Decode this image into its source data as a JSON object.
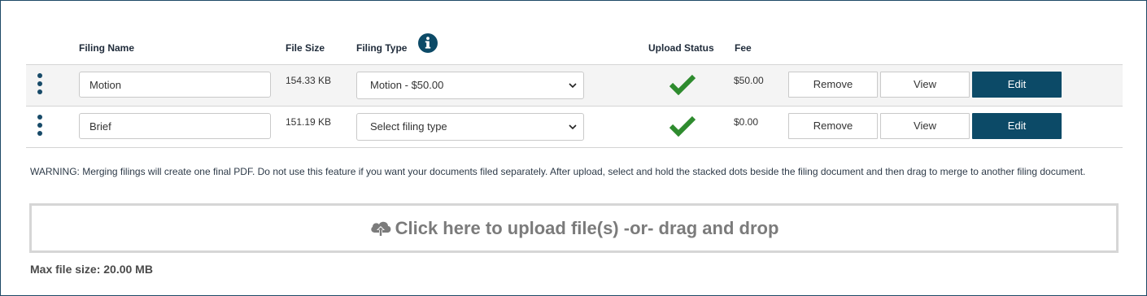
{
  "headers": {
    "filing_name": "Filing Name",
    "file_size": "File Size",
    "filing_type": "Filing Type",
    "upload_status": "Upload Status",
    "fee": "Fee"
  },
  "rows": [
    {
      "name": "Motion",
      "size": "154.33 KB",
      "type": "Motion - $50.00",
      "status": "uploaded",
      "fee": "$50.00",
      "remove_label": "Remove",
      "view_label": "View",
      "edit_label": "Edit"
    },
    {
      "name": "Brief",
      "size": "151.19 KB",
      "type": "Select filing type",
      "status": "uploaded",
      "fee": "$0.00",
      "remove_label": "Remove",
      "view_label": "View",
      "edit_label": "Edit"
    }
  ],
  "warning": "WARNING: Merging filings will create one final PDF. Do not use this feature if you want your documents filed separately. After upload, select and hold the stacked dots beside the filing document and then drag to merge to another filing document.",
  "upload": {
    "label": "Click here to upload file(s) -or- drag and drop",
    "icon": "cloud-upload-icon"
  },
  "max_file_size": "Max file size: 20.00 MB",
  "colors": {
    "primary": "#0c4a67",
    "success": "#2e8b2e",
    "border": "#1e4a66"
  }
}
